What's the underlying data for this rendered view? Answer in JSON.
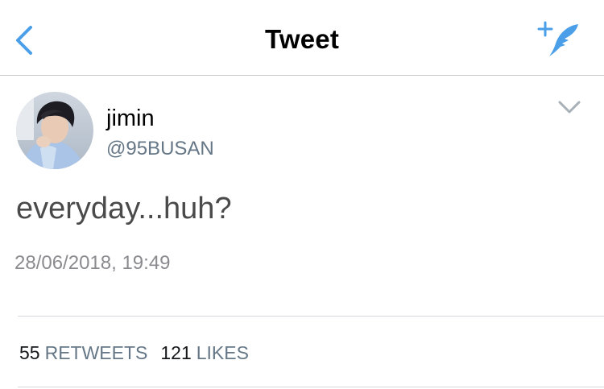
{
  "navbar": {
    "title": "Tweet",
    "back_icon": "chevron-left-icon",
    "compose_icon": "compose-feather-icon",
    "accent": "#4a9fe8"
  },
  "tweet": {
    "author": {
      "display_name": "jimin",
      "handle": "@95BUSAN"
    },
    "text": "everyday...huh?",
    "timestamp": "28/06/2018, 19:49"
  },
  "stats": {
    "retweets_count": "55",
    "retweets_label": "RETWEETS",
    "likes_count": "121",
    "likes_label": "LIKES"
  }
}
